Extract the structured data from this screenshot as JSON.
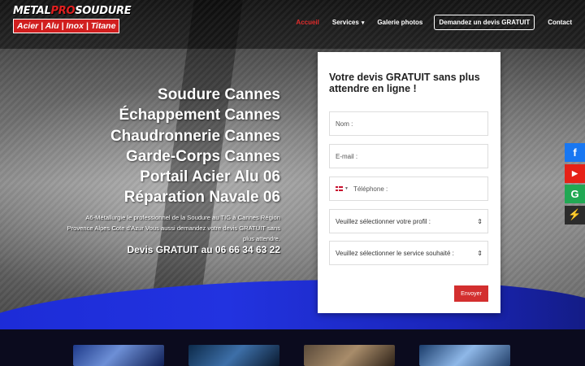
{
  "logo": {
    "part1": "METAL",
    "part2": "PRO",
    "part3": "SOUDURE",
    "tagline": "Acier | Alu | Inox | Titane"
  },
  "nav": {
    "items": [
      {
        "label": "Accueil",
        "active": true
      },
      {
        "label": "Services",
        "has_dropdown": true
      },
      {
        "label": "Galerie photos"
      }
    ],
    "cta_label": "Demandez un devis GRATUIT",
    "contact_label": "Contact",
    "active_color": "#e02b2b"
  },
  "hero": {
    "headlines": [
      "Soudure Cannes",
      "Échappement Cannes",
      "Chaudronnerie Cannes",
      "Garde-Corps Cannes",
      "Portail Acier Alu 06",
      "Réparation Navale 06"
    ],
    "intro": "A6-Métallurgie le professionnel de la Soudure au TIG à Cannes Région Provence Alpes Cote d'Azur Vous aussi demandez votre devis GRATUIT sans plus attendre.",
    "phone_line": "Devis GRATUIT au 06 66 34 63 22"
  },
  "form": {
    "title": "Votre devis GRATUIT sans plus attendre en ligne !",
    "name_placeholder": "Nom :",
    "email_placeholder": "E-mail :",
    "phone_placeholder": "Téléphone :",
    "profile_select": "Veuillez sélectionner votre profil :",
    "service_select": "Veuillez sélectionner le service souhaité :",
    "submit_label": "Envoyer",
    "submit_color": "#d32f2f"
  },
  "social": {
    "facebook_glyph": "f",
    "youtube_glyph": "▶",
    "google_glyph": "G",
    "messenger_glyph": "⚡",
    "colors": {
      "facebook": "#1877f2",
      "youtube": "#e62117",
      "google": "#21a854",
      "messenger": "#2b2b2b"
    }
  },
  "theme": {
    "accent_blue": "#1c2bd6",
    "brand_red": "#d11f1f"
  }
}
